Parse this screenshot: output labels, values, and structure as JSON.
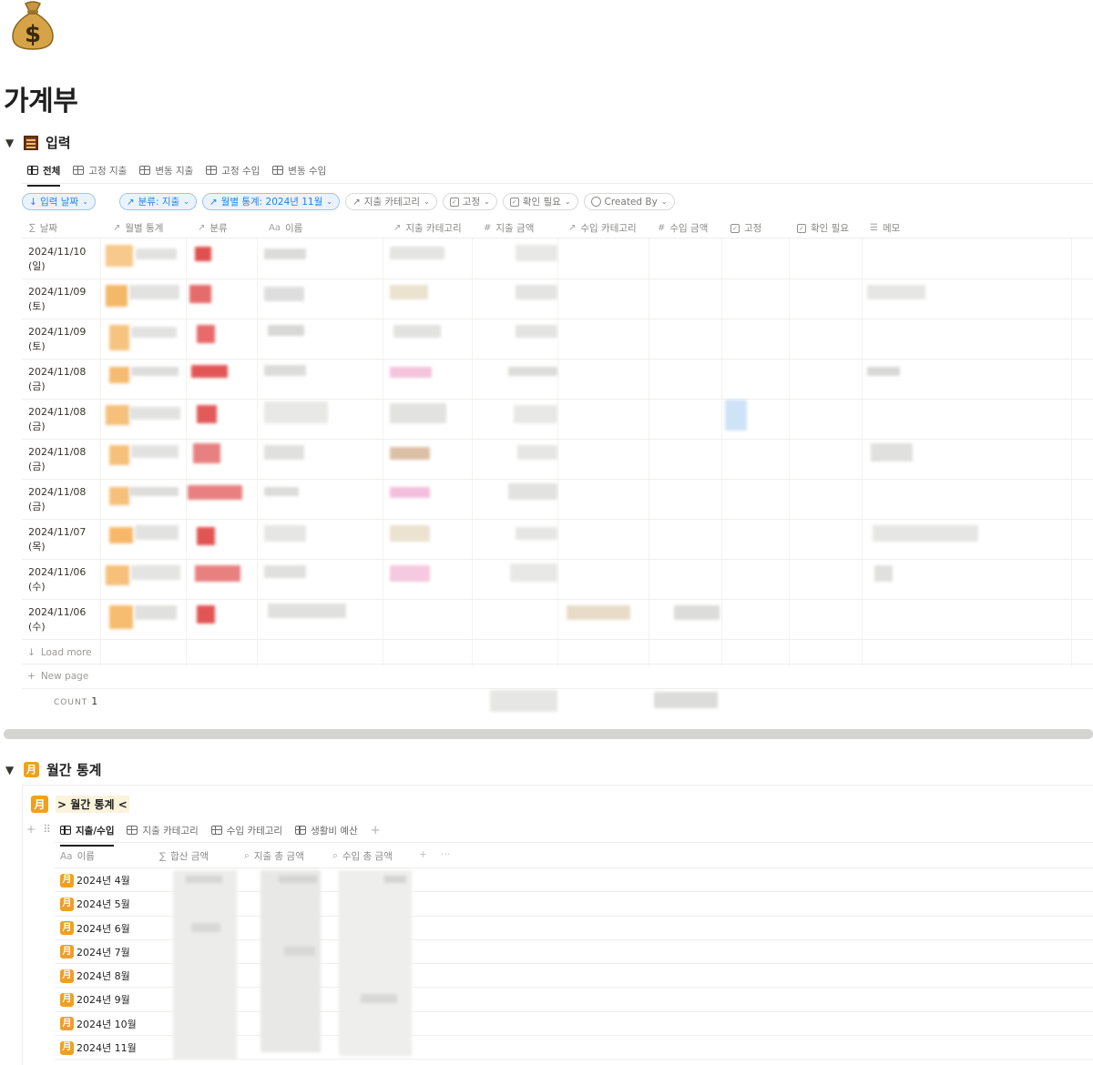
{
  "page": {
    "icon": "money-bag-icon",
    "title": "가계부"
  },
  "input_section": {
    "title": "입력",
    "icon": "abacus-icon",
    "tabs": [
      {
        "label": "전체",
        "active": true
      },
      {
        "label": "고정 지출"
      },
      {
        "label": "변동 지출"
      },
      {
        "label": "고정 수입"
      },
      {
        "label": "변동 수입"
      }
    ],
    "filters": {
      "sort": "↓ 입력 날짜",
      "category": "분류: 지출",
      "monthly": "월별 통계: 2024년 11월",
      "expense_category": "지출 카테고리",
      "fixed": "고정",
      "check": "확인 필요",
      "created_by": "Created By"
    },
    "columns": {
      "date": "날짜",
      "monthly_stats": "월별 통계",
      "category": "분류",
      "name": "이름",
      "expense_category": "지출 카테고리",
      "expense_amount": "지출 금액",
      "income_category": "수입 카테고리",
      "income_amount": "수입 금액",
      "fixed": "고정",
      "check": "확인 필요",
      "memo": "메모"
    },
    "rows": [
      {
        "date": "2024/11/10\n(일)"
      },
      {
        "date": "2024/11/09\n(토)"
      },
      {
        "date": "2024/11/09\n(토)"
      },
      {
        "date": "2024/11/08\n(금)"
      },
      {
        "date": "2024/11/08\n(금)"
      },
      {
        "date": "2024/11/08\n(금)"
      },
      {
        "date": "2024/11/08\n(금)"
      },
      {
        "date": "2024/11/07\n(목)"
      },
      {
        "date": "2024/11/06\n(수)"
      },
      {
        "date": "2024/11/06\n(수)"
      }
    ],
    "load_more": "Load more",
    "new_page": "New page",
    "count_label": "COUNT",
    "count_value": "1"
  },
  "monthly_section": {
    "title": "월간 통계",
    "icon": "moon-calendar-icon",
    "linked_title": "> 월간 통계 <",
    "tabs": [
      {
        "label": "지출/수입",
        "active": true
      },
      {
        "label": "지출 카테고리"
      },
      {
        "label": "수입 카테고리"
      },
      {
        "label": "생활비 예산"
      }
    ],
    "columns": {
      "name": "이름",
      "sum": "합산 금액",
      "expense_total": "지출 총 금액",
      "income_total": "수입 총 금액"
    },
    "rows": [
      {
        "name": "2024년 4월"
      },
      {
        "name": "2024년 5월"
      },
      {
        "name": "2024년 6월"
      },
      {
        "name": "2024년 7월"
      },
      {
        "name": "2024년 8월"
      },
      {
        "name": "2024년 9월"
      },
      {
        "name": "2024년 10월"
      },
      {
        "name": "2024년 11월"
      }
    ]
  },
  "colors": {
    "accent_blue": "#2383e2",
    "moon_orange": "#f0a020"
  }
}
